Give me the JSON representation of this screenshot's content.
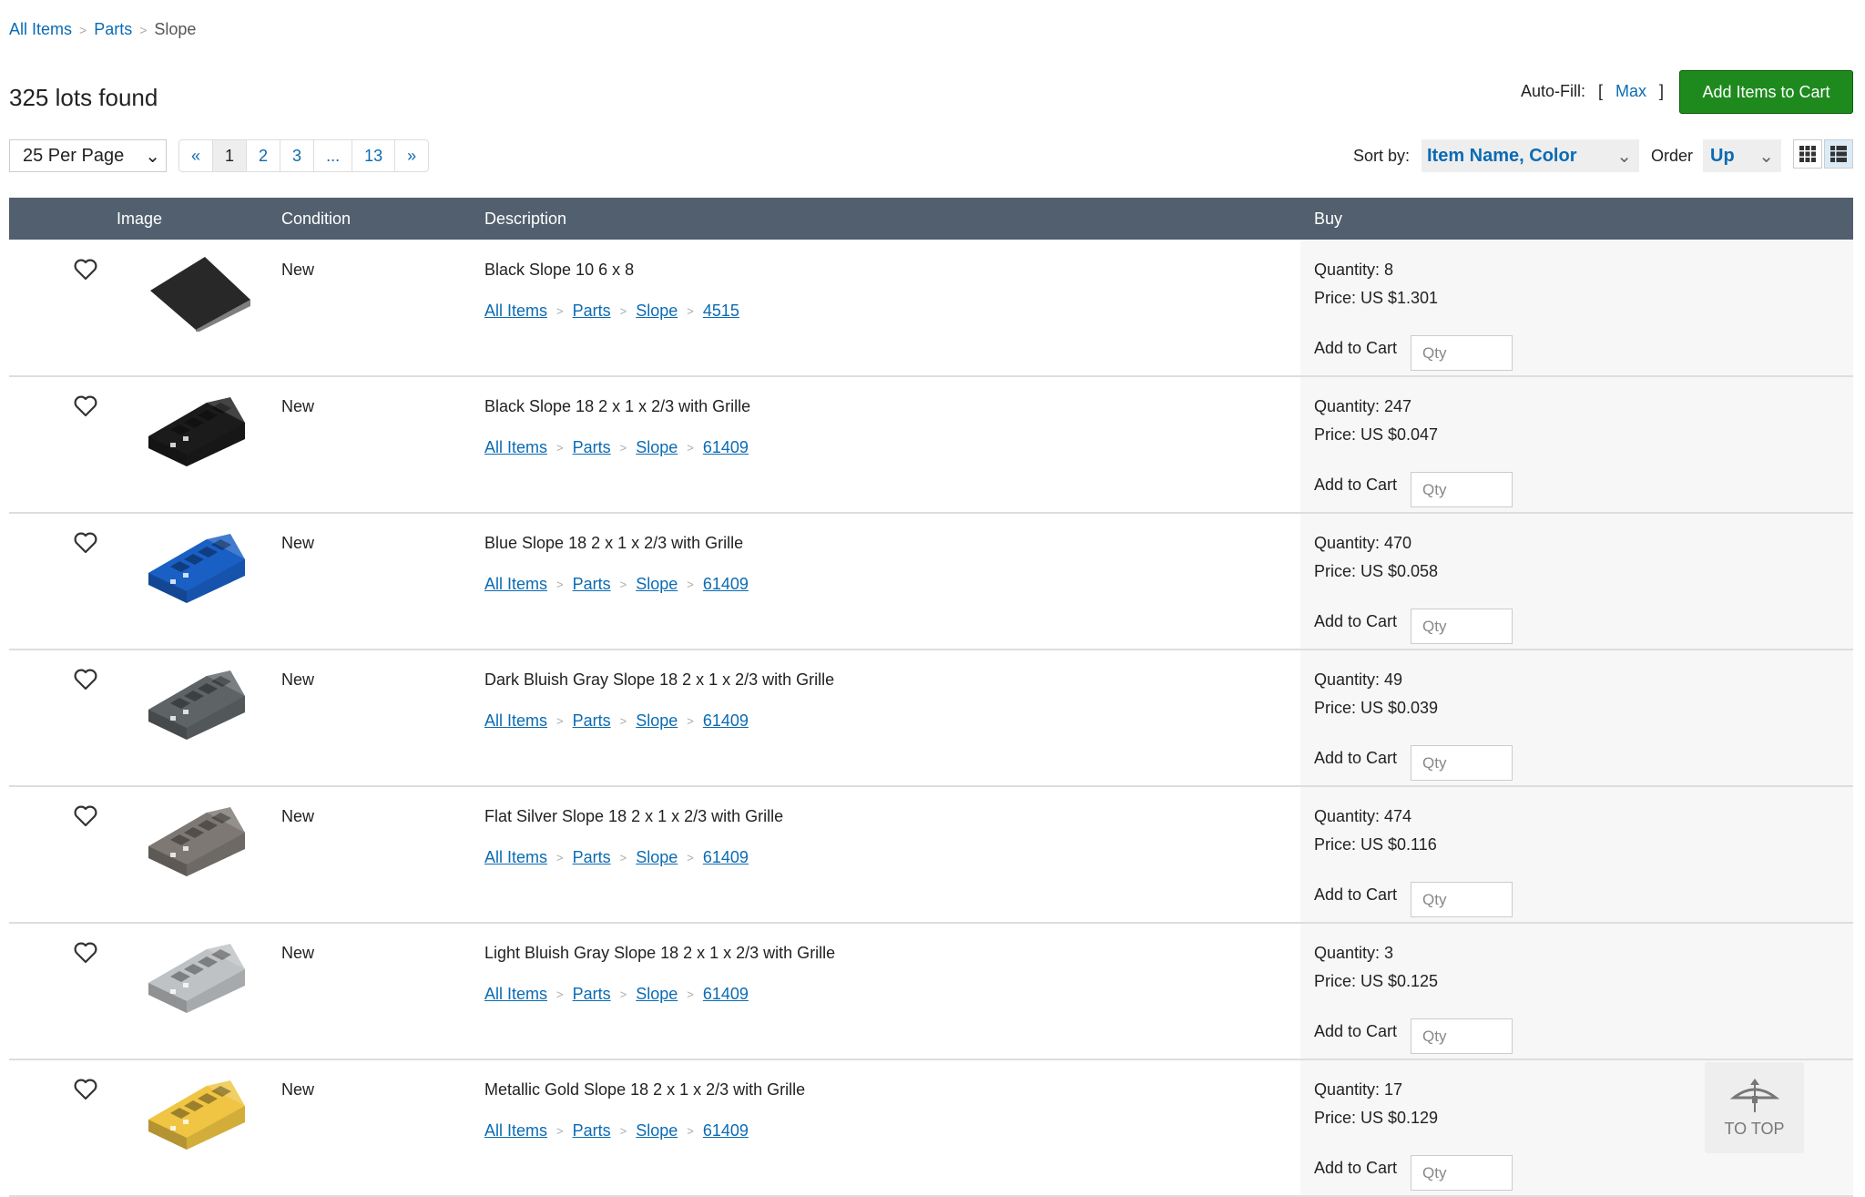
{
  "breadcrumb": [
    "All Items",
    "Parts",
    "Slope"
  ],
  "title": "325 lots found",
  "autofill": {
    "label": "Auto-Fill:",
    "open": "[",
    "max": "Max",
    "close": "]"
  },
  "add_items_label": "Add Items to Cart",
  "per_page": "25 Per Page",
  "pagination": [
    "«",
    "1",
    "2",
    "3",
    "...",
    "13",
    "»"
  ],
  "current_page": "1",
  "sort": {
    "label": "Sort by:",
    "value": "Item Name, Color",
    "order_label": "Order",
    "order_value": "Up"
  },
  "columns": {
    "image": "Image",
    "condition": "Condition",
    "description": "Description",
    "buy": "Buy"
  },
  "labels": {
    "add_to_cart": "Add to Cart",
    "qty_placeholder": "Qty"
  },
  "items": [
    {
      "condition": "New",
      "name": "Black Slope 10 6 x 8",
      "links": [
        "All Items",
        "Parts",
        "Slope",
        "4515"
      ],
      "quantity": "Quantity: 8",
      "price": "Price: US $1.301",
      "color": "#1b1b1b",
      "grille": false
    },
    {
      "condition": "New",
      "name": "Black Slope 18 2 x 1 x 2/3 with Grille",
      "links": [
        "All Items",
        "Parts",
        "Slope",
        "61409"
      ],
      "quantity": "Quantity: 247",
      "price": "Price: US $0.047",
      "color": "#1b1b1b",
      "grille": true
    },
    {
      "condition": "New",
      "name": "Blue Slope 18 2 x 1 x 2/3 with Grille",
      "links": [
        "All Items",
        "Parts",
        "Slope",
        "61409"
      ],
      "quantity": "Quantity: 470",
      "price": "Price: US $0.058",
      "color": "#1a5fc4",
      "grille": true
    },
    {
      "condition": "New",
      "name": "Dark Bluish Gray Slope 18 2 x 1 x 2/3 with Grille",
      "links": [
        "All Items",
        "Parts",
        "Slope",
        "61409"
      ],
      "quantity": "Quantity: 49",
      "price": "Price: US $0.039",
      "color": "#5e6366",
      "grille": true
    },
    {
      "condition": "New",
      "name": "Flat Silver Slope 18 2 x 1 x 2/3 with Grille",
      "links": [
        "All Items",
        "Parts",
        "Slope",
        "61409"
      ],
      "quantity": "Quantity: 474",
      "price": "Price: US $0.116",
      "color": "#7d7873",
      "grille": true
    },
    {
      "condition": "New",
      "name": "Light Bluish Gray Slope 18 2 x 1 x 2/3 with Grille",
      "links": [
        "All Items",
        "Parts",
        "Slope",
        "61409"
      ],
      "quantity": "Quantity: 3",
      "price": "Price: US $0.125",
      "color": "#bfc2c4",
      "grille": true
    },
    {
      "condition": "New",
      "name": "Metallic Gold Slope 18 2 x 1 x 2/3 with Grille",
      "links": [
        "All Items",
        "Parts",
        "Slope",
        "61409"
      ],
      "quantity": "Quantity: 17",
      "price": "Price: US $0.129",
      "color": "#f0c543",
      "grille": true
    }
  ],
  "to_top": "TO TOP"
}
